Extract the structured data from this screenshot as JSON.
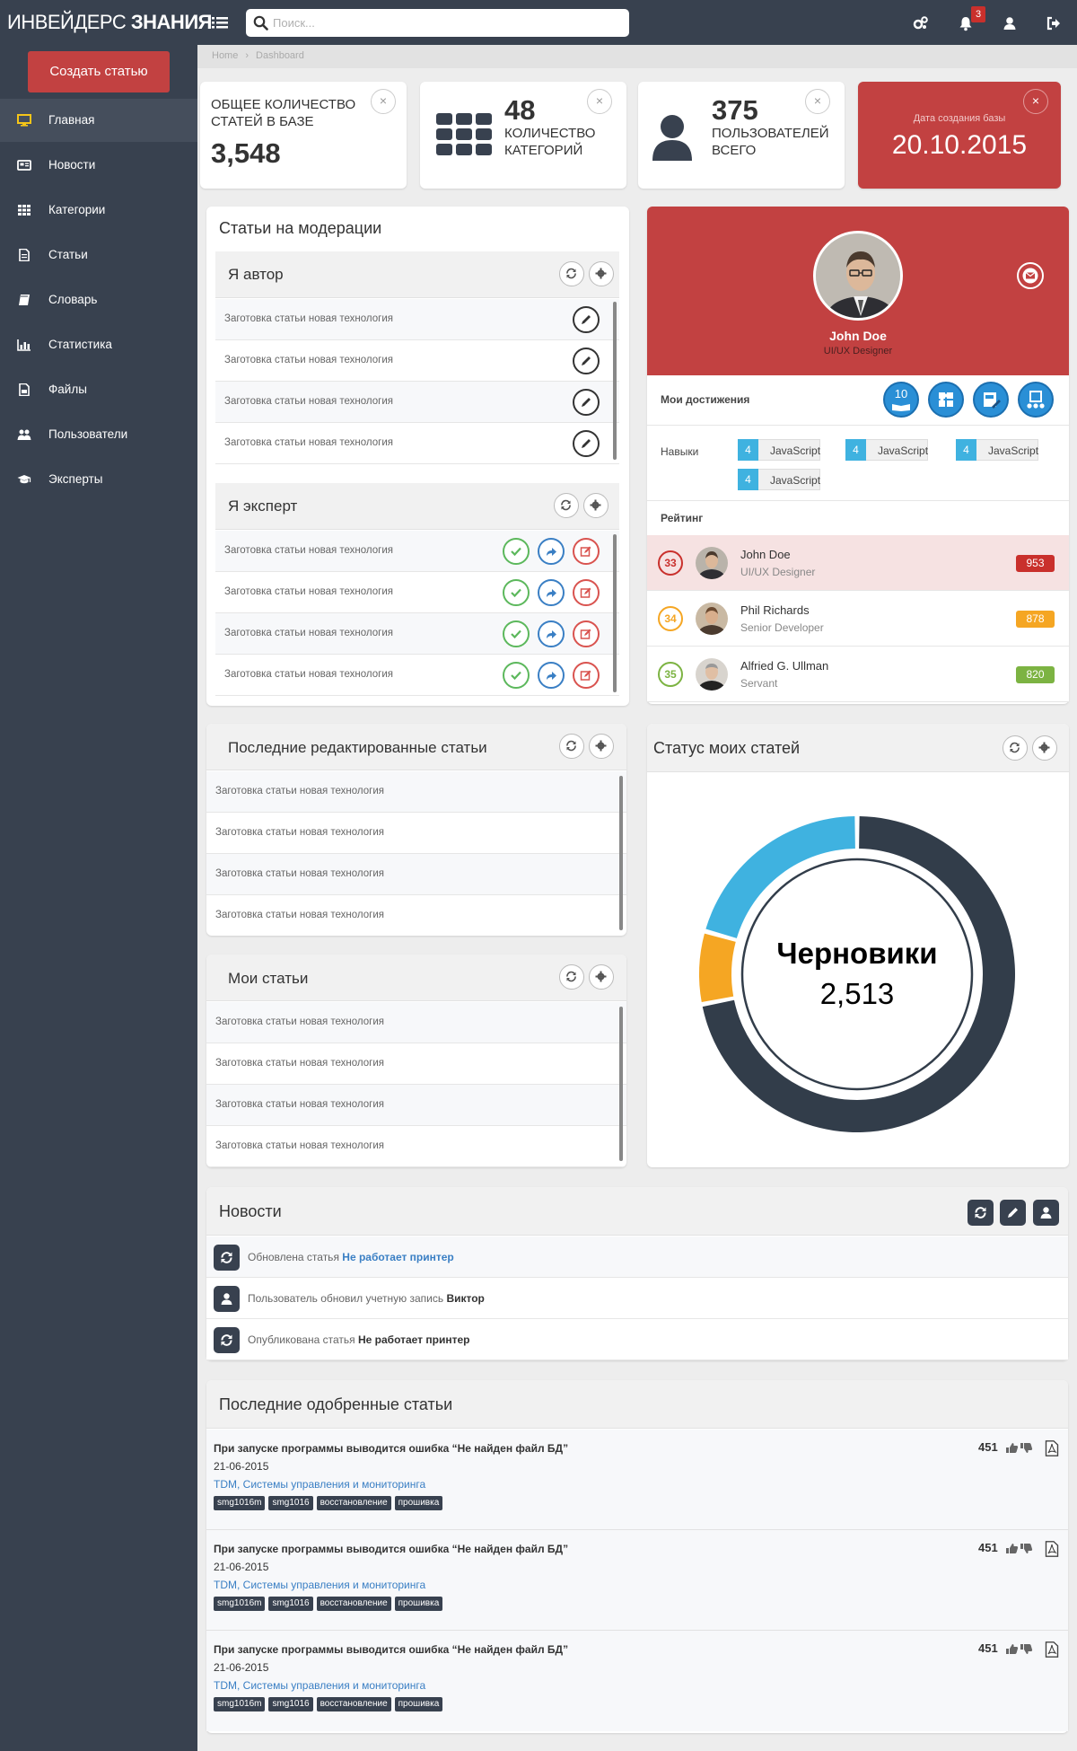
{
  "app": {
    "brand_light": "ИНВЕЙДЕРС",
    "brand_bold": "ЗНАНИЯ",
    "search_placeholder": "Поиск...",
    "notifications_count": "3"
  },
  "sidebar": {
    "create_button": "Создать статью",
    "items": [
      {
        "label": "Главная",
        "icon": "desktop-icon",
        "active": true
      },
      {
        "label": "Новости",
        "icon": "newspaper-icon"
      },
      {
        "label": "Категории",
        "icon": "grid-icon"
      },
      {
        "label": "Статьи",
        "icon": "document-icon"
      },
      {
        "label": "Словарь",
        "icon": "book-icon"
      },
      {
        "label": "Статистика",
        "icon": "bar-chart-icon"
      },
      {
        "label": "Файлы",
        "icon": "file-icon"
      },
      {
        "label": "Пользователи",
        "icon": "users-icon"
      },
      {
        "label": "Эксперты",
        "icon": "graduation-cap-icon"
      }
    ]
  },
  "breadcrumb": [
    "Home",
    "Dashboard"
  ],
  "stats": {
    "articles": {
      "label": "ОБЩЕЕ КОЛИЧЕСТВО СТАТЕЙ В БАЗЕ",
      "value": "3,548"
    },
    "categories": {
      "value": "48",
      "label": "КОЛИЧЕСТВО КАТЕГОРИЙ"
    },
    "users": {
      "value": "375",
      "label": "ПОЛЬЗОВАТЕЛЕЙ ВСЕГО"
    },
    "db_date": {
      "label": "Дата создания базы",
      "value": "20.10.2015"
    }
  },
  "moderation": {
    "title": "Статьи на модерации",
    "author_title": "Я автор",
    "author_rows": [
      "Заготовка статьи новая технология",
      "Заготовка статьи новая технология",
      "Заготовка статьи новая технология",
      "Заготовка статьи новая технология"
    ],
    "expert_title": "Я эксперт",
    "expert_rows": [
      "Заготовка статьи новая технология",
      "Заготовка статьи новая технология",
      "Заготовка статьи новая технология",
      "Заготовка статьи новая технология"
    ]
  },
  "profile": {
    "name": "John Doe",
    "role": "UI/UX Designer",
    "achievements_label": "Мои достижения",
    "achievement_badge_number": "10",
    "skills_label": "Навыки",
    "skills": [
      {
        "level": "4",
        "name": "JavaScript"
      },
      {
        "level": "4",
        "name": "JavaScript"
      },
      {
        "level": "4",
        "name": "JavaScript"
      },
      {
        "level": "4",
        "name": "JavaScript"
      }
    ],
    "rating_label": "Рейтинг",
    "ranking": [
      {
        "rank": "33",
        "name": "John Doe",
        "role": "UI/UX Designer",
        "score": "953",
        "color": "#c9302c"
      },
      {
        "rank": "34",
        "name": "Phil Richards",
        "role": "Senior Developer",
        "score": "878",
        "color": "#f5a623"
      },
      {
        "rank": "35",
        "name": "Alfried G. Ullman",
        "role": "Servant",
        "score": "820",
        "color": "#7cb342"
      }
    ]
  },
  "recent_edited": {
    "title": "Последние редактированные статьи",
    "rows": [
      "Заготовка статьи новая технология",
      "Заготовка статьи новая технология",
      "Заготовка статьи новая технология",
      "Заготовка статьи новая технология"
    ]
  },
  "my_articles": {
    "title": "Мои статьи",
    "rows": [
      "Заготовка статьи новая технология",
      "Заготовка статьи новая технология",
      "Заготовка статьи новая технология",
      "Заготовка статьи новая технология"
    ]
  },
  "status_panel": {
    "title": "Статус моих статей"
  },
  "chart_data": {
    "type": "pie",
    "title": "Статус моих статей",
    "center_label": "Черновики",
    "center_value": "2,513",
    "slices": [
      {
        "value": 2513,
        "color": "#323d4a"
      },
      {
        "value": 260,
        "color": "#f5a623"
      },
      {
        "value": 720,
        "color": "#3fb2e0"
      }
    ],
    "colors": {
      "drafts": "#323d4a",
      "orange": "#f5a623",
      "blue": "#3fb2e0"
    }
  },
  "news": {
    "title": "Новости",
    "items": [
      {
        "icon": "refresh-icon",
        "text": "Обновлена статья",
        "link": "Не работает принтер"
      },
      {
        "icon": "user-icon",
        "text": "Пользователь обновил учетную запись",
        "bold": "Виктор"
      },
      {
        "icon": "refresh-icon",
        "text": "Опубликована статья",
        "bold": "Не работает принтер"
      }
    ]
  },
  "approved": {
    "title": "Последние одобренные статьи",
    "articles": [
      {
        "title": "При запуске программы выводится ошибка “Не найден файл БД”",
        "date": "21-06-2015",
        "category": "TDM, Системы управления и мониторинга",
        "count": "451",
        "tags": [
          "smg1016m",
          "smg1016",
          "восстановление",
          "прошивка"
        ]
      },
      {
        "title": "При запуске программы выводится ошибка “Не найден файл БД”",
        "date": "21-06-2015",
        "category": "TDM, Системы управления и мониторинга",
        "count": "451",
        "tags": [
          "smg1016m",
          "smg1016",
          "восстановление",
          "прошивка"
        ]
      },
      {
        "title": "При запуске программы выводится ошибка “Не найден файл БД”",
        "date": "21-06-2015",
        "category": "TDM, Системы управления и мониторинга",
        "count": "451",
        "tags": [
          "smg1016m",
          "smg1016",
          "восстановление",
          "прошивка"
        ]
      }
    ]
  },
  "colors": {
    "accent_red": "#c24141",
    "sidebar_bg": "#38414f",
    "link_blue": "#3a7fc4"
  }
}
